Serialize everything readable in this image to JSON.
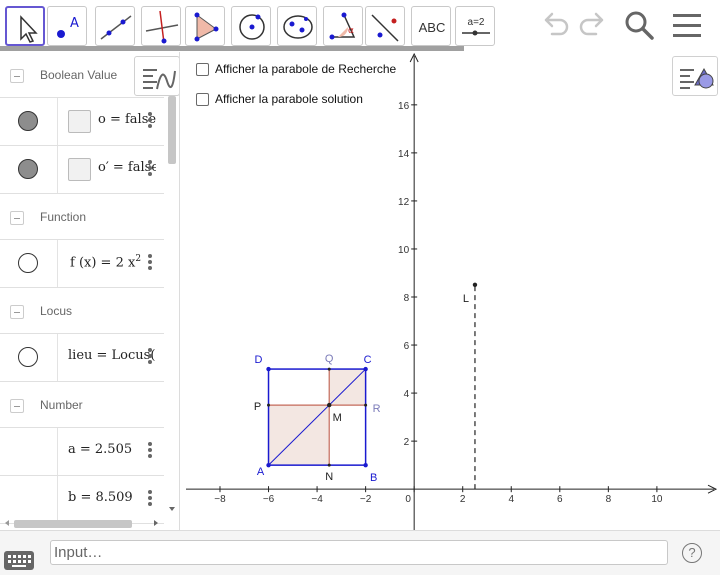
{
  "toolbar": {
    "tools": [
      {
        "name": "move-tool",
        "icon": "arrow-pointer-icon",
        "active": true
      },
      {
        "name": "point-tool",
        "icon": "point-icon",
        "label": "A"
      },
      {
        "name": "line-tool",
        "icon": "line-through-points-icon"
      },
      {
        "name": "perpendicular-line-tool",
        "icon": "perpendicular-line-icon"
      },
      {
        "name": "polygon-tool",
        "icon": "polygon-icon"
      },
      {
        "name": "circle-center-point-tool",
        "icon": "circle-center-icon"
      },
      {
        "name": "ellipse-tool",
        "icon": "ellipse-icon"
      },
      {
        "name": "angle-tool",
        "icon": "angle-icon",
        "label": "α"
      },
      {
        "name": "reflect-tool",
        "icon": "reflect-about-line-icon"
      },
      {
        "name": "text-tool",
        "icon": "text-icon",
        "label": "ABC"
      },
      {
        "name": "slider-tool",
        "icon": "slider-icon",
        "label": "a=2"
      }
    ],
    "undo_icon": "undo-icon",
    "redo_icon": "redo-icon",
    "search_icon": "search-icon",
    "menu_icon": "menu-icon"
  },
  "algebra": {
    "groups": [
      {
        "label": "Boolean Value",
        "items": [
          {
            "marble": "filled",
            "checkbox": true,
            "expr": "o = false"
          },
          {
            "marble": "filled",
            "checkbox": true,
            "expr": "o′ = false"
          }
        ]
      },
      {
        "label": "Function",
        "items": [
          {
            "marble": "empty",
            "expr": "f (x)  =  2 x",
            "sup": "2"
          }
        ]
      },
      {
        "label": "Locus",
        "items": [
          {
            "marble": "empty",
            "expr": "lieu  =  Locus(L,"
          }
        ]
      },
      {
        "label": "Number",
        "items": [
          {
            "marble": "none",
            "expr": "a  =  2.505"
          },
          {
            "marble": "none",
            "expr": "b  =  8.509"
          }
        ]
      }
    ]
  },
  "graphics": {
    "checkbox1": "Afficher la parabole de Recherche",
    "checkbox2": "Afficher la parabole solution",
    "colors": {
      "axis": "#222222",
      "square": "#1a1ad0",
      "fill": "#f3e7e2",
      "point": "#222222",
      "segment": "#c46a5a",
      "label_blue": "#1a1ad0"
    },
    "chart_data": {
      "type": "scatter",
      "xlim": [
        -9.4,
        12.6
      ],
      "ylim": [
        -1.7,
        18.2
      ],
      "x_ticks": [
        -8,
        -6,
        -4,
        -2,
        0,
        2,
        4,
        6,
        8,
        10
      ],
      "y_ticks": [
        2,
        4,
        6,
        8,
        10,
        12,
        14,
        16
      ],
      "points": [
        {
          "name": "A",
          "x": -6,
          "y": 1
        },
        {
          "name": "B",
          "x": -2,
          "y": 1
        },
        {
          "name": "C",
          "x": -2,
          "y": 5
        },
        {
          "name": "D",
          "x": -6,
          "y": 5
        },
        {
          "name": "M",
          "x": -3.5,
          "y": 3.5
        },
        {
          "name": "N",
          "x": -3.5,
          "y": 1
        },
        {
          "name": "Q",
          "x": -3.5,
          "y": 5
        },
        {
          "name": "P",
          "x": -6,
          "y": 3.5
        },
        {
          "name": "R",
          "x": -2,
          "y": 3.5
        },
        {
          "name": "L",
          "x": 2.505,
          "y": 8.509
        }
      ],
      "dashed_vertical": {
        "x": 2.505,
        "y_from": 0,
        "y_to": 8.509
      }
    }
  },
  "input": {
    "placeholder": "Input…",
    "help_label": "?",
    "keyboard_icon": "keyboard-icon"
  }
}
